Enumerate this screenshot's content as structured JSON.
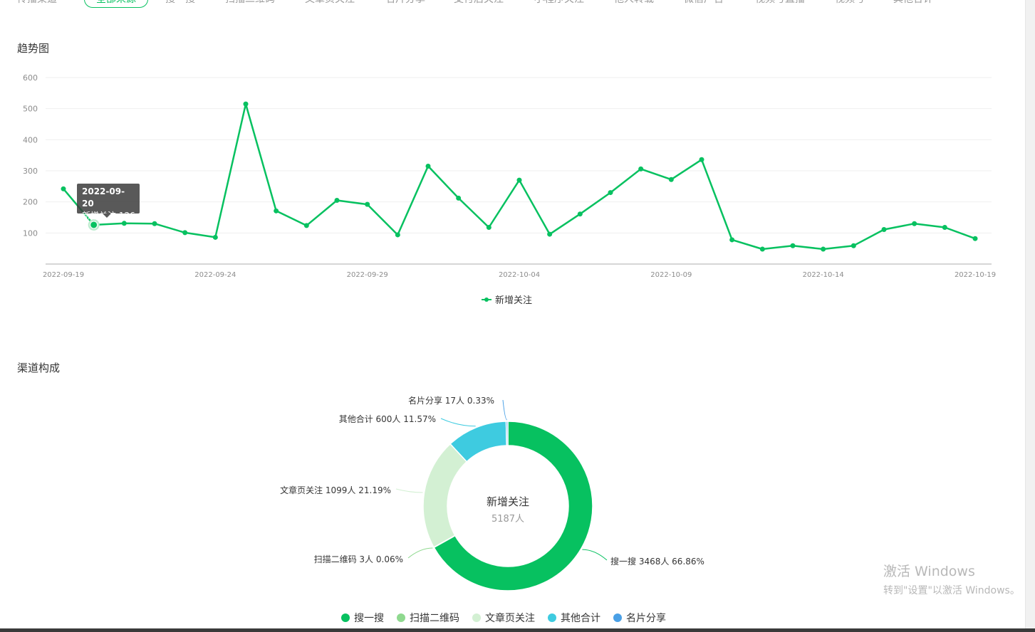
{
  "tabs": {
    "group_label": "传播渠道",
    "items": [
      "全部来源",
      "搜一搜",
      "扫描二维码",
      "文章页关注",
      "名片分享",
      "支付后关注",
      "小程序关注",
      "他人转载",
      "微信广告",
      "视频号直播",
      "视频号",
      "其他合计"
    ],
    "active_index": 0
  },
  "trend": {
    "title": "趋势图",
    "tooltip": {
      "date": "2022-09-20",
      "series": "新增关注",
      "value": "126"
    },
    "legend": "新增关注"
  },
  "channel": {
    "title": "渠道构成",
    "center_title": "新增关注",
    "center_value": "5187人"
  },
  "chart_data": [
    {
      "type": "line",
      "series": [
        {
          "name": "新增关注",
          "values": [
            242,
            126,
            131,
            130,
            101,
            86,
            515,
            171,
            124,
            205,
            192,
            94,
            315,
            212,
            118,
            270,
            96,
            161,
            230,
            306,
            272,
            336,
            78,
            48,
            59,
            48,
            59,
            111,
            130,
            118,
            82
          ]
        }
      ],
      "x": [
        "2022-09-19",
        "2022-09-20",
        "2022-09-21",
        "2022-09-22",
        "2022-09-23",
        "2022-09-24",
        "2022-09-25",
        "2022-09-26",
        "2022-09-27",
        "2022-09-28",
        "2022-09-29",
        "2022-09-30",
        "2022-10-01",
        "2022-10-02",
        "2022-10-03",
        "2022-10-04",
        "2022-10-05",
        "2022-10-06",
        "2022-10-07",
        "2022-10-08",
        "2022-10-09",
        "2022-10-10",
        "2022-10-11",
        "2022-10-12",
        "2022-10-13",
        "2022-10-14",
        "2022-10-15",
        "2022-10-16",
        "2022-10-17",
        "2022-10-18",
        "2022-10-19"
      ],
      "xticks": [
        "2022-09-19",
        "2022-09-24",
        "2022-09-29",
        "2022-10-04",
        "2022-10-09",
        "2022-10-14",
        "2022-10-19"
      ],
      "yticks": [
        100,
        200,
        300,
        400,
        500,
        600
      ],
      "ylim": [
        0,
        600
      ],
      "grid": true,
      "legend_position": "bottom",
      "color": "#07c160"
    },
    {
      "type": "pie",
      "slices": [
        {
          "name": "搜一搜",
          "count": 3468,
          "percent": 66.86,
          "label": "搜一搜 3468人 66.86%",
          "color": "#07c160"
        },
        {
          "name": "扫描二维码",
          "count": 3,
          "percent": 0.06,
          "label": "扫描二维码 3人 0.06%",
          "color": "#8fd98f"
        },
        {
          "name": "文章页关注",
          "count": 1099,
          "percent": 21.19,
          "label": "文章页关注 1099人 21.19%",
          "color": "#d3f0d3"
        },
        {
          "name": "其他合计",
          "count": 600,
          "percent": 11.57,
          "label": "其他合计 600人 11.57%",
          "color": "#3ecbe0"
        },
        {
          "name": "名片分享",
          "count": 17,
          "percent": 0.33,
          "label": "名片分享 17人 0.33%",
          "color": "#4aa0e6"
        }
      ],
      "legend_position": "bottom"
    }
  ],
  "watermark": {
    "line1": "激活 Windows",
    "line2": "转到\"设置\"以激活 Windows。"
  }
}
